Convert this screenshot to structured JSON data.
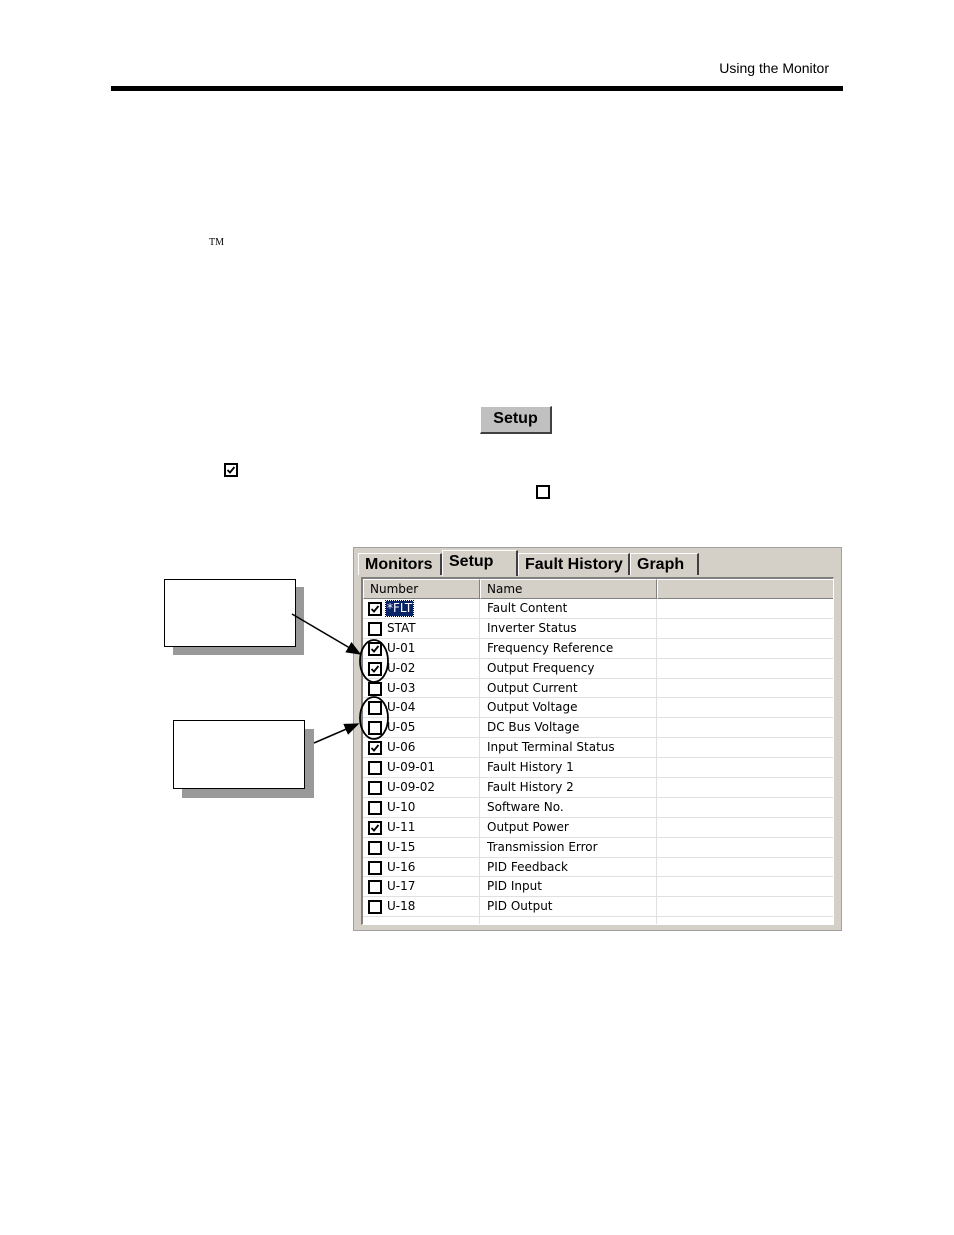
{
  "header": {
    "title": "Using the Monitor"
  },
  "body": {
    "trademark": "TM"
  },
  "setup_button": {
    "label": "Setup"
  },
  "window": {
    "tabs": [
      {
        "label": "Monitors",
        "active": false
      },
      {
        "label": "Setup",
        "active": true
      },
      {
        "label": "Fault History",
        "active": false
      },
      {
        "label": "Graph",
        "active": false
      }
    ],
    "columns": [
      "Number",
      "Name"
    ],
    "rows": [
      {
        "number": "*FLT",
        "name": "Fault Content",
        "checked": true,
        "selected": true
      },
      {
        "number": "STAT",
        "name": "Inverter Status",
        "checked": false,
        "selected": false
      },
      {
        "number": "U-01",
        "name": "Frequency Reference",
        "checked": true,
        "selected": false
      },
      {
        "number": "U-02",
        "name": "Output Frequency",
        "checked": true,
        "selected": false
      },
      {
        "number": "U-03",
        "name": "Output Current",
        "checked": false,
        "selected": false
      },
      {
        "number": "U-04",
        "name": "Output Voltage",
        "checked": false,
        "selected": false
      },
      {
        "number": "U-05",
        "name": "DC Bus Voltage",
        "checked": false,
        "selected": false
      },
      {
        "number": "U-06",
        "name": "Input Terminal Status",
        "checked": true,
        "selected": false
      },
      {
        "number": "U-09-01",
        "name": "Fault History 1",
        "checked": false,
        "selected": false
      },
      {
        "number": "U-09-02",
        "name": "Fault History 2",
        "checked": false,
        "selected": false
      },
      {
        "number": "U-10",
        "name": "Software No.",
        "checked": false,
        "selected": false
      },
      {
        "number": "U-11",
        "name": "Output Power",
        "checked": true,
        "selected": false
      },
      {
        "number": "U-15",
        "name": "Transmission Error",
        "checked": false,
        "selected": false
      },
      {
        "number": "U-16",
        "name": "PID Feedback",
        "checked": false,
        "selected": false
      },
      {
        "number": "U-17",
        "name": "PID Input",
        "checked": false,
        "selected": false
      },
      {
        "number": "U-18",
        "name": "PID Output",
        "checked": false,
        "selected": false
      }
    ]
  }
}
